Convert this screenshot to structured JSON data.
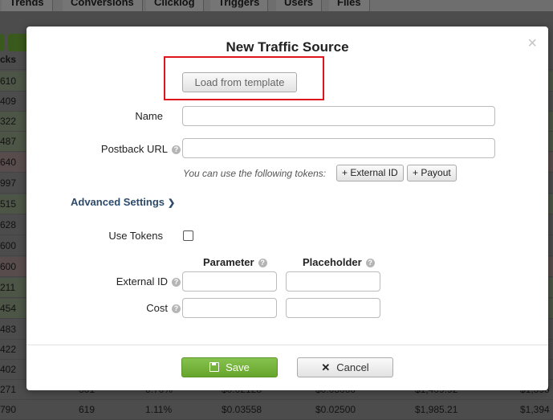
{
  "background": {
    "tabs": [
      "Trends",
      "Conversions",
      "Clicklog",
      "Triggers",
      "Users",
      "Files"
    ],
    "first_col_header": "cks",
    "first_col_values": [
      "610",
      "409",
      "322",
      "487",
      "640",
      "997",
      "515",
      "628",
      "600",
      "600",
      "211",
      "454",
      "483",
      "422",
      "402",
      "271",
      "790"
    ],
    "last_row": {
      "c1": "619",
      "c2": "1.11%",
      "c3": "$0.03558",
      "c4": "$0.02500",
      "c5": "$1,985.21",
      "c6": "$1,394"
    },
    "partial_row": {
      "c1": "301",
      "c2": "0.70%",
      "c3": "$0.02128",
      "c4": "$0.03000",
      "c5": "$1,409.92",
      "c6": "$1,398"
    }
  },
  "modal": {
    "title": "New Traffic Source",
    "close_glyph": "×",
    "template_button": "Load from template",
    "name_label": "Name",
    "name_value": "",
    "postback_label": "Postback URL",
    "postback_value": "",
    "tokens_hint": "You can use the following tokens:",
    "token_external_id": "+ External ID",
    "token_payout": "+ Payout",
    "advanced_label": "Advanced Settings",
    "use_tokens_label": "Use Tokens",
    "use_tokens_checked": false,
    "parameter_header": "Parameter",
    "placeholder_header": "Placeholder",
    "external_id_label": "External ID",
    "cost_label": "Cost",
    "save_button": "Save",
    "cancel_button": "Cancel"
  },
  "colors": {
    "highlight": "#e0141c",
    "save": "#74b33c",
    "advanced_link": "#2c4a6b"
  }
}
